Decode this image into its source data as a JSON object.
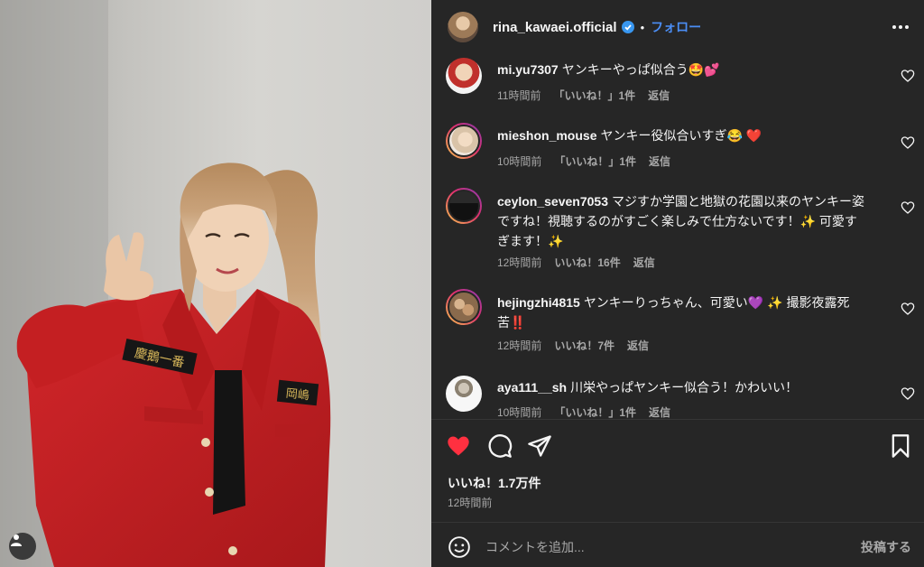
{
  "post": {
    "username": "rina_kawaei.official",
    "separator": "•",
    "follow_label": "フォロー",
    "badge_text_left": "慶鵝一番",
    "badge_text_right": "岡嶋"
  },
  "comments": [
    {
      "username": "mi.yu7307",
      "text": "ヤンキーやっぱ似合う🤩💕",
      "time": "11時間前",
      "likes": "「いいね！」1件",
      "reply": "返信",
      "ring": false
    },
    {
      "username": "mieshon_mouse",
      "text": "ヤンキー役似合いすぎ😂 ❤️",
      "time": "10時間前",
      "likes": "「いいね！」1件",
      "reply": "返信",
      "ring": true
    },
    {
      "username": "ceylon_seven7053",
      "text": "マジすか学園と地獄の花園以来のヤンキー姿ですね！視聴するのがすごく楽しみで仕方ないです！✨ 可愛すぎます！✨",
      "time": "12時間前",
      "likes": "いいね！16件",
      "reply": "返信",
      "ring": true
    },
    {
      "username": "hejingzhi4815",
      "text": "ヤンキーりっちゃん、可愛い💜 ✨ 撮影夜露死苦‼️",
      "time": "12時間前",
      "likes": "いいね！7件",
      "reply": "返信",
      "ring": true
    },
    {
      "username": "aya111__sh",
      "text": "川栄やっぱヤンキー似合う！かわいい！",
      "time": "10時間前",
      "likes": "「いいね！」1件",
      "reply": "返信",
      "ring": false
    }
  ],
  "summary": {
    "likes": "いいね！1.7万件",
    "posted": "12時間前"
  },
  "add_comment": {
    "placeholder": "コメントを追加...",
    "post_label": "投稿する"
  },
  "colors": {
    "panel_bg": "#262626",
    "text": "#f5f5f5",
    "muted": "#a8a8a8",
    "link_blue": "#4b8ef5",
    "like_red": "#ff3040",
    "jacket_red": "#c8201f"
  },
  "icons": [
    "user-tag-icon",
    "verified-icon",
    "more-icon",
    "heart-icon",
    "comment-icon",
    "share-icon",
    "bookmark-icon",
    "emoji-icon"
  ]
}
